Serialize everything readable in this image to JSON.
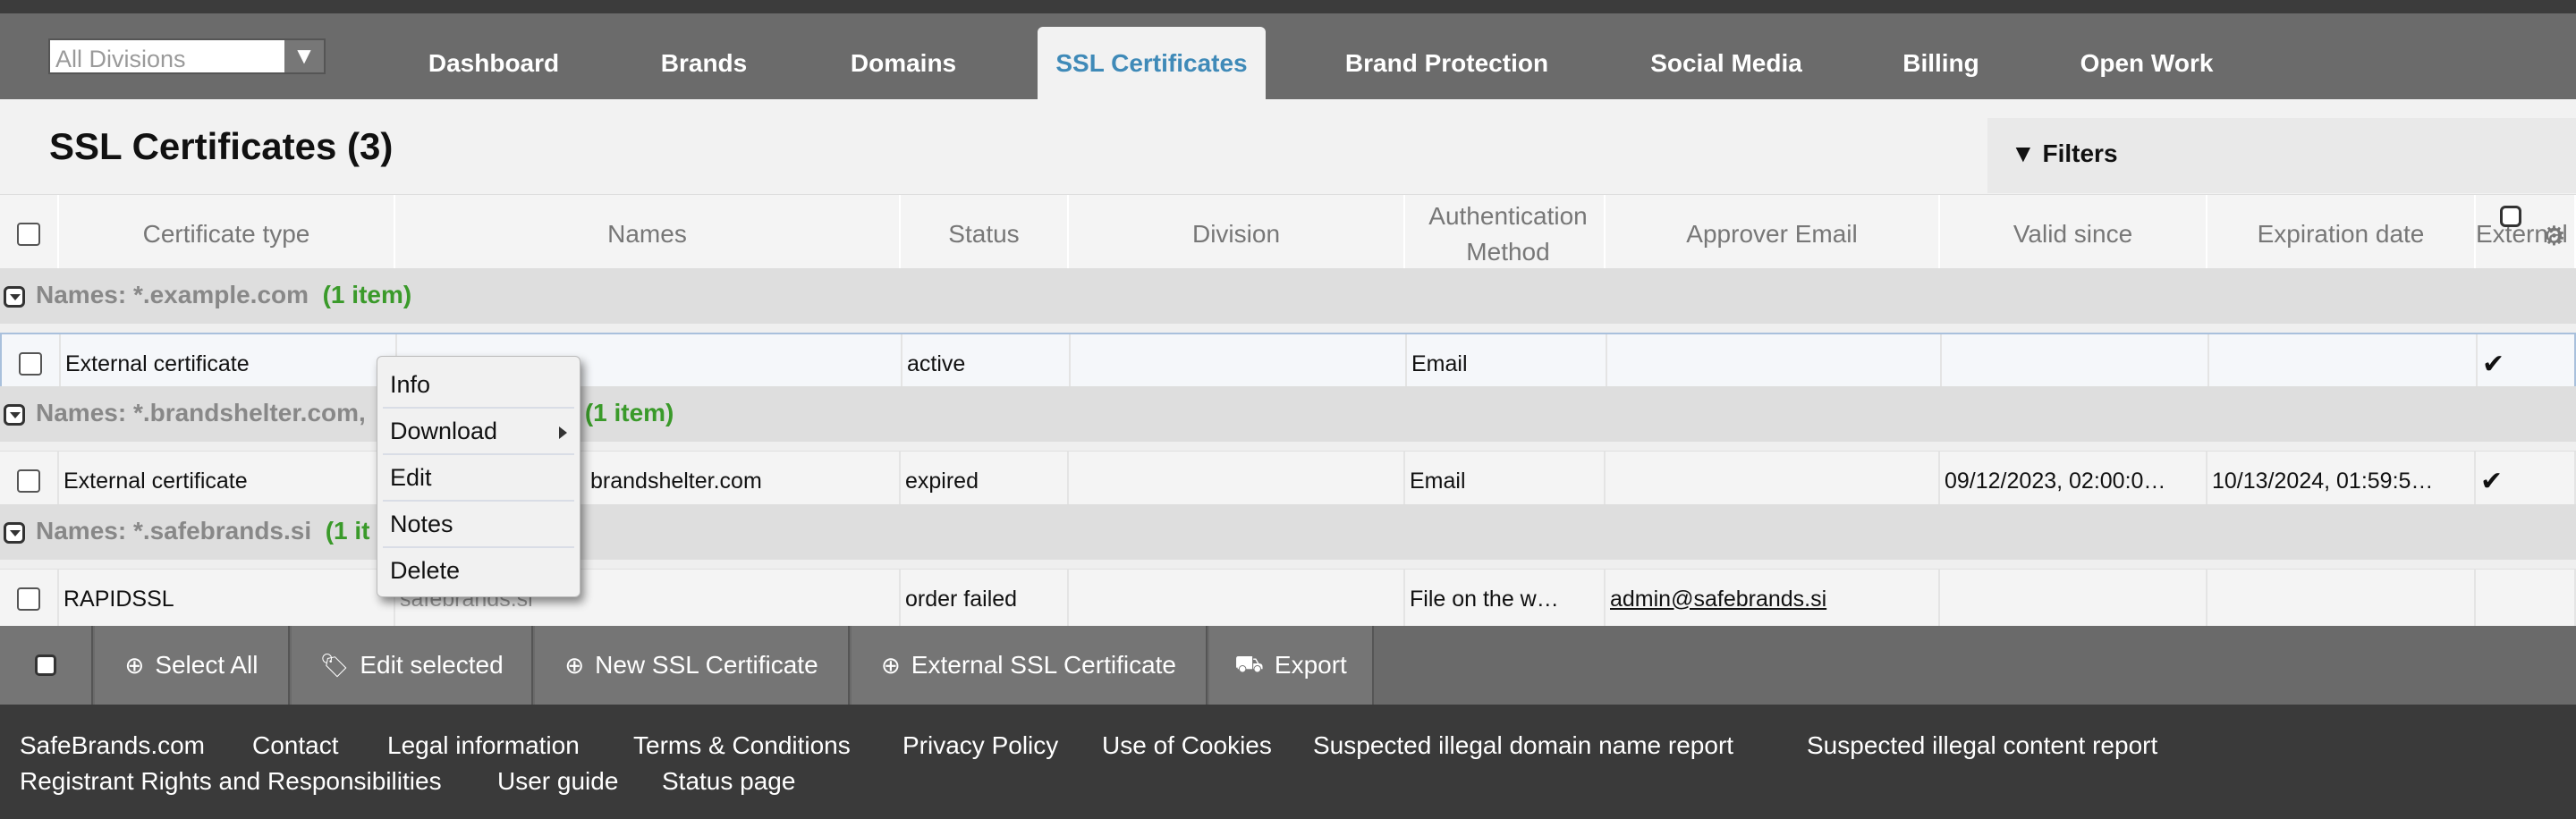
{
  "nav": {
    "division_select": "All Divisions",
    "tabs": [
      {
        "label": "Dashboard"
      },
      {
        "label": "Brands"
      },
      {
        "label": "Domains"
      },
      {
        "label": "SSL Certificates"
      },
      {
        "label": "Brand Protection"
      },
      {
        "label": "Social Media"
      },
      {
        "label": "Billing"
      },
      {
        "label": "Open Work"
      }
    ]
  },
  "page": {
    "title": "SSL Certificates  (3)",
    "filters_label": "Filters"
  },
  "table": {
    "columns": [
      "Certificate type",
      "Names",
      "Status",
      "Division",
      "Authentication Method",
      "Approver Email",
      "Valid since",
      "Expiration date",
      "External"
    ],
    "groups": [
      {
        "label": "Names:  *.example.com",
        "count": "(1 item)",
        "row": {
          "cert_type": "External certificate",
          "names": "",
          "status": "active",
          "division": "",
          "auth": "Email",
          "approver": "",
          "valid_since": "",
          "expiration": "",
          "external": "✔"
        }
      },
      {
        "label": "Names:  *.brandshelter.com,",
        "count": "(1 item)",
        "row": {
          "cert_type": "External certificate",
          "names": "brandshelter.com",
          "status": "expired",
          "division": "",
          "auth": "Email",
          "approver": "",
          "valid_since": "09/12/2023, 02:00:0…",
          "expiration": "10/13/2024, 01:59:5…",
          "external": "✔"
        }
      },
      {
        "label": "Names:  *.safebrands.si",
        "count": "(1 it",
        "row": {
          "cert_type": "RAPIDSSL",
          "names": "safebrands.si",
          "status": "order failed",
          "division": "",
          "auth": "File on the w…",
          "approver": "admin@safebrands.si",
          "valid_since": "",
          "expiration": "",
          "external": ""
        }
      }
    ]
  },
  "context_menu": {
    "items": [
      "Info",
      "Download",
      "Edit",
      "Notes",
      "Delete"
    ]
  },
  "actions": {
    "select_all": "Select All",
    "edit_selected": "Edit selected",
    "new_ssl": "New SSL Certificate",
    "external_ssl": "External SSL Certificate",
    "export": "Export"
  },
  "footer": {
    "links": [
      "SafeBrands.com",
      "Contact",
      "Legal information",
      "Terms & Conditions",
      "Privacy Policy",
      "Use of Cookies",
      "Suspected illegal domain name report",
      "Suspected illegal content report",
      "Registrant Rights and Responsibilities",
      "User guide",
      "Status page"
    ]
  },
  "colors": {
    "nav_bg": "#6b6b6b",
    "active_tab_text": "#3f8ab8",
    "group_count": "#3a9a2a",
    "footer_bg": "#3a3a3a"
  }
}
